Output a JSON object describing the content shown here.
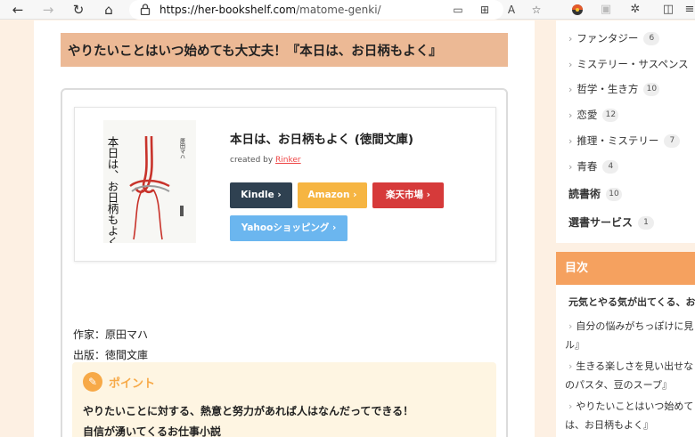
{
  "browser": {
    "url_host": "https://her-bookshelf.com",
    "url_path": "/matome-genki/"
  },
  "article": {
    "title": "やりたいことはいつ始めても大丈夫！『本日は、お日柄もよく』",
    "book": {
      "cover_title": "本日は、お日柄もよく",
      "cover_author": "原田マハ",
      "title": "本日は、お日柄もよく (徳間文庫)",
      "created_by_prefix": "created by ",
      "created_by_link": "Rinker",
      "buttons": {
        "kindle": "Kindle ›",
        "amazon": "Amazon ›",
        "rakuten": "楽天市場 ›",
        "yahoo": "Yahooショッピング ›"
      }
    },
    "author_line": "作家：原田マハ",
    "publisher_line": "出版：徳間文庫",
    "point": {
      "label": "ポイント",
      "line1": "やりたいことに対する、熱意と努力があれば人はなんだってできる！",
      "line2": "自信が湧いてくるお仕事小説"
    }
  },
  "sidebar": {
    "categories": [
      {
        "label": "ファンタジー",
        "count": "6"
      },
      {
        "label": "ミステリー・サスペンス",
        "count": ""
      },
      {
        "label": "哲学・生き方",
        "count": "10"
      },
      {
        "label": "恋愛",
        "count": "12"
      },
      {
        "label": "推理・ミステリー",
        "count": "7"
      },
      {
        "label": "青春",
        "count": "4"
      }
    ],
    "main_categories": [
      {
        "label": "読書術",
        "count": "10"
      },
      {
        "label": "選書サービス",
        "count": "1"
      }
    ],
    "toc": {
      "heading": "目次",
      "items": [
        "元気とやる気が出てくる、お",
        "自分の悩みがちっぽけに見",
        "ル』",
        "生きる楽しさを見い出せな",
        "のパスタ、豆のスープ』",
        "やりたいことはいつ始めて",
        "は、お日柄もよく』"
      ]
    }
  },
  "colors": {
    "title_bg": "#ecb995",
    "toc_header": "#f5a15f",
    "kindle": "#2f4151",
    "amazon": "#f6b542",
    "rakuten": "#d63a3a",
    "yahoo": "#6bb6ef",
    "point_accent": "#f7a947",
    "page_bg": "#fdf0e3"
  }
}
